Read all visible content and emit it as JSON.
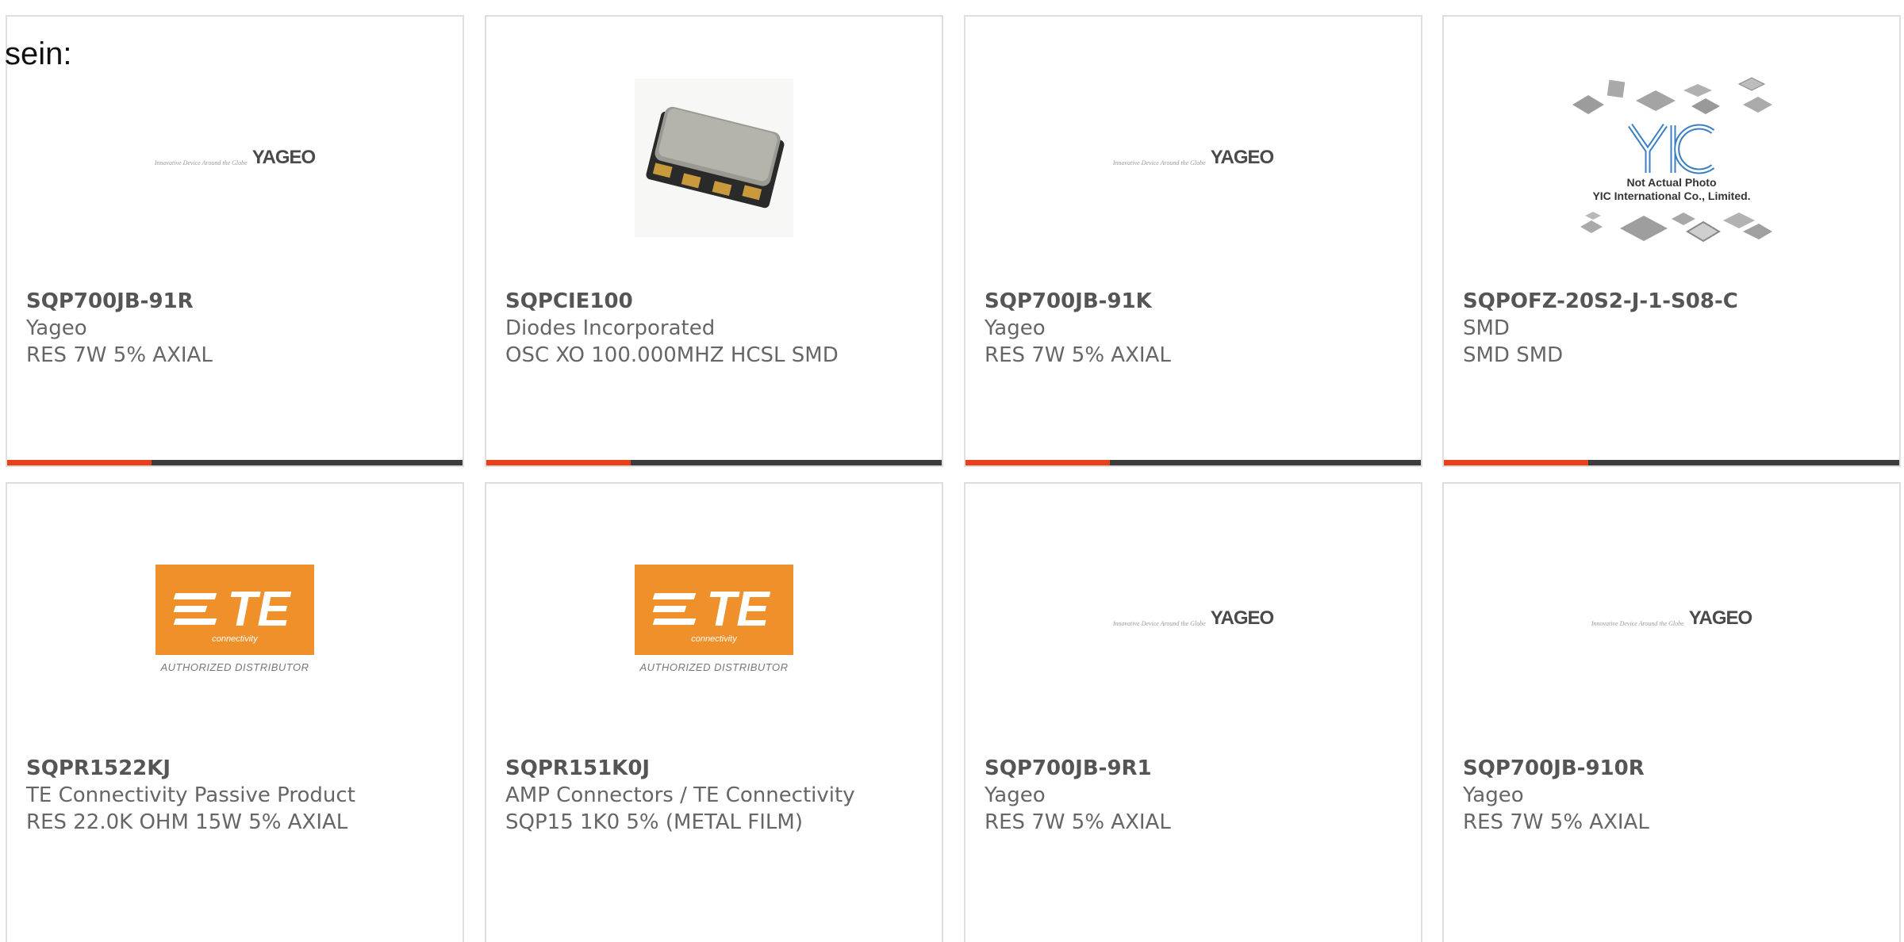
{
  "intro_text": "sein:",
  "colors": {
    "accent": "#e8411a",
    "bar": "#3c3c3c",
    "border": "#dedede",
    "te_orange": "#f0902a"
  },
  "logos": {
    "yageo_tagline": "Innovative Device Around the Globe",
    "yageo_word": "YAGEO",
    "te_word": "TE",
    "te_sub": "connectivity",
    "te_auth": "AUTHORIZED DISTRIBUTOR",
    "yic_line1": "Not Actual Photo",
    "yic_line2": "YIC International Co., Limited."
  },
  "products": [
    {
      "part": "SQP700JB-91R",
      "mfr": "Yageo",
      "desc": "RES 7W 5% AXIAL",
      "image": "yageo-logo"
    },
    {
      "part": "SQPCIE100",
      "mfr": "Diodes Incorporated",
      "desc": "OSC XO 100.000MHZ HCSL SMD",
      "image": "oscillator-photo"
    },
    {
      "part": "SQP700JB-91K",
      "mfr": "Yageo",
      "desc": "RES 7W 5% AXIAL",
      "image": "yageo-logo"
    },
    {
      "part": "SQPOFZ-20S2-J-1-S08-C",
      "mfr": "SMD",
      "desc": "SMD SMD",
      "image": "yic-logo"
    },
    {
      "part": "SQPR1522KJ",
      "mfr": "TE Connectivity Passive Product",
      "desc": "RES 22.0K OHM 15W 5% AXIAL",
      "image": "te-logo"
    },
    {
      "part": "SQPR151K0J",
      "mfr": "AMP Connectors / TE Connectivity",
      "desc": "SQP15 1K0 5% (METAL FILM)",
      "image": "te-logo"
    },
    {
      "part": "SQP700JB-9R1",
      "mfr": "Yageo",
      "desc": "RES 7W 5% AXIAL",
      "image": "yageo-logo"
    },
    {
      "part": "SQP700JB-910R",
      "mfr": "Yageo",
      "desc": "RES 7W 5% AXIAL",
      "image": "yageo-logo"
    }
  ]
}
